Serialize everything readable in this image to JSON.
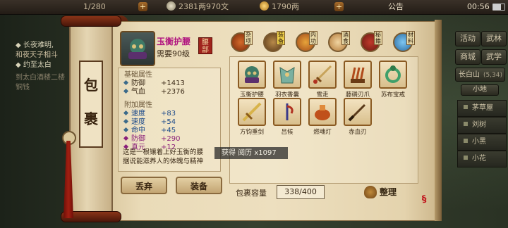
{
  "topbar": {
    "energy": "1/280",
    "silver": "2381两970文",
    "gold": "1790两",
    "announce": "公告",
    "time": "00:56"
  },
  "quest": {
    "line1": "◆ 长夜难明,",
    "line2": "和夜天子相斗",
    "line3": "◆ 约至太白",
    "line4": "到太白酒楼二楼",
    "line5": "铜钱"
  },
  "rightmenu": {
    "activity": "活动",
    "rank": "武林",
    "shop": "商城",
    "martial": "武学",
    "location": "长白山",
    "coords": "(5,34)",
    "minimap": "小地"
  },
  "npcs": [
    "茅草屋",
    "刘树",
    "小黑",
    "小花"
  ],
  "panel": {
    "title1": "包",
    "title2": "裹"
  },
  "item": {
    "name": "玉衡护腰",
    "requirement": "需要90级",
    "slot": "腰部",
    "desc1": "这是一根镶着上好玉衡的腰",
    "desc2": "据说能滋养人的体魄与精神"
  },
  "stats": {
    "base_title": "基础属性",
    "base": [
      {
        "k": "防御",
        "v": "+1413"
      },
      {
        "k": "气血",
        "v": "+2376"
      }
    ],
    "extra_title": "附加属性",
    "extra": [
      {
        "k": "速度",
        "v": "+83"
      },
      {
        "k": "速度",
        "v": "+54"
      },
      {
        "k": "命中",
        "v": "+45"
      },
      {
        "k": "防御",
        "v": "+290"
      },
      {
        "k": "真元",
        "v": "+12"
      }
    ]
  },
  "buttons": {
    "discard": "丢弃",
    "equip": "装备"
  },
  "tabs": [
    "杂项",
    "装备",
    "内功",
    "酒食",
    "秘籍",
    "材料"
  ],
  "grid": [
    "玉衡护腰",
    "羽衣香囊",
    "雪走",
    "藤磷刃爪",
    "苏布宝戒",
    "方钧重剑",
    "吕候",
    "燃魂灯",
    "赤血刃"
  ],
  "footer": {
    "capacity_label": "包裹容量",
    "capacity_value": "338/400",
    "sort": "整理"
  },
  "toast": {
    "text": "获得 阅历 x1097"
  }
}
